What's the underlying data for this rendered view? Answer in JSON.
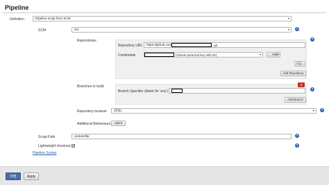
{
  "section": {
    "title": "Pipeline"
  },
  "definition": {
    "label": "Definition",
    "value": "Pipeline script from SCM"
  },
  "scm": {
    "label": "SCM",
    "value": "Git"
  },
  "repositories": {
    "label": "Repositories",
    "url_label": "Repository URL",
    "url_prefix": "https://github.com/",
    "url_suffix": ".git",
    "credentials_label": "Credentials",
    "credentials_value": "(Github personal key with ID)",
    "add_credentials_label": "← Add▾",
    "advanced_label": "고급...",
    "add_repository_label": "Add Repository"
  },
  "branches": {
    "label": "Branches to build",
    "specifier_label": "Branch Specifier (blank for 'any')",
    "specifier_prefix": "*/",
    "delete_label": "X",
    "add_branch_label": "Add Branch"
  },
  "browser": {
    "label": "Repository browser",
    "value": "(자동)"
  },
  "behaviours": {
    "label": "Additional Behaviours",
    "add_label": "Add ▾"
  },
  "script": {
    "label": "Script Path",
    "value": "Jenkinsfile"
  },
  "lightweight": {
    "label": "Lightweight checkout",
    "checked_glyph": "✔"
  },
  "syntax_link": "Pipeline Syntax",
  "help_glyph": "?",
  "caret_glyph": "▾",
  "footer": {
    "save_label": "저장",
    "apply_label": "Apply"
  },
  "colors": {
    "primary": "#4a6da7",
    "help": "#2f5fb3",
    "danger": "#c9302c",
    "link": "#2e5ca8"
  }
}
